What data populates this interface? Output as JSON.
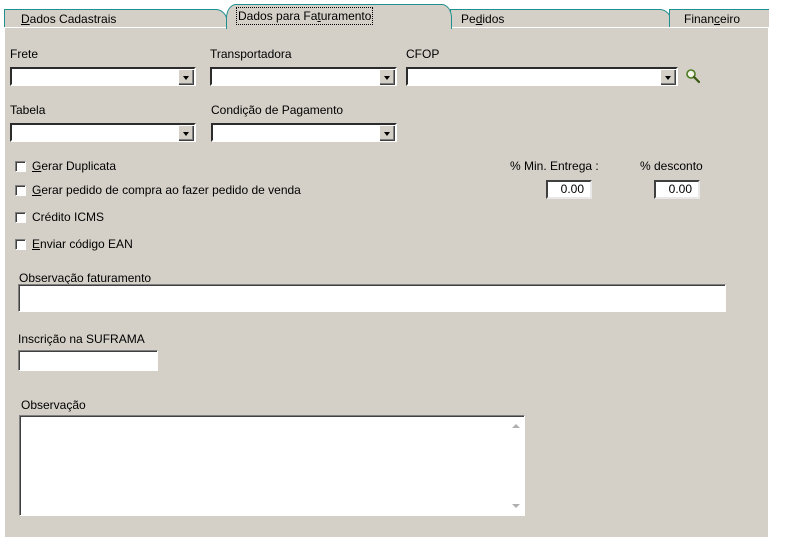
{
  "tabs": [
    {
      "label_pre": "",
      "label_u": "D",
      "label_post": "ados Cadastrais"
    },
    {
      "label_pre": "",
      "label_u": "D",
      "label_post": "ados para Faturamento",
      "alt_pre": "Dados para Fa",
      "alt_u": "t",
      "alt_post": "uramento"
    },
    {
      "label_pre": "Pe",
      "label_u": "d",
      "label_post": "idos"
    },
    {
      "label_pre": "Finan",
      "label_u": "c",
      "label_post": "eiro"
    }
  ],
  "fields": {
    "frete": {
      "label": "Frete",
      "value": ""
    },
    "transportadora": {
      "label": "Transportadora",
      "value": ""
    },
    "cfop": {
      "label": "CFOP",
      "value": ""
    },
    "tabela": {
      "label": "Tabela",
      "value": ""
    },
    "condicao": {
      "label": "Condição de Pagamento",
      "value": ""
    }
  },
  "checkboxes": [
    {
      "u": "G",
      "rest": "erar Duplicata",
      "checked": false
    },
    {
      "u": "G",
      "rest": "erar pedido de compra ao fazer pedido de venda",
      "checked": false
    },
    {
      "u": "",
      "rest": "Crédito ICMS",
      "checked": false
    },
    {
      "u": "E",
      "rest": "nviar código EAN",
      "checked": false
    }
  ],
  "min_entrega": {
    "label": "% Min. Entrega :",
    "value": "0.00"
  },
  "desconto": {
    "label": "% desconto",
    "value": "0.00"
  },
  "obs_faturamento": {
    "label": "Observação faturamento",
    "value": ""
  },
  "suframa": {
    "label": "Inscrição na SUFRAMA",
    "value": ""
  },
  "observacao": {
    "label": "Observação",
    "value": ""
  }
}
